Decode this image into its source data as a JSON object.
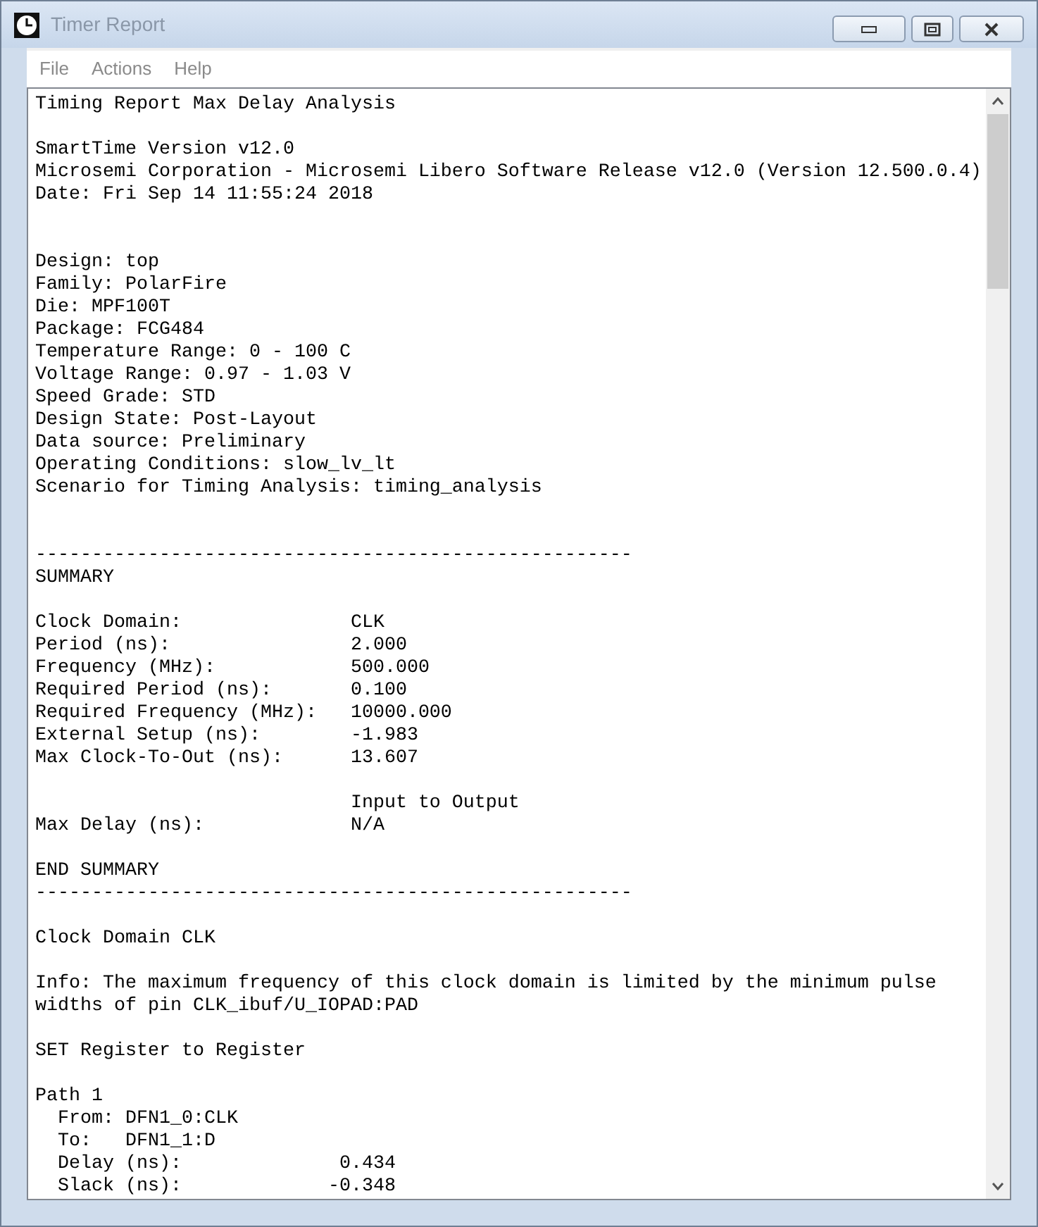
{
  "window": {
    "title": "Timer Report"
  },
  "menu": [
    {
      "label": "File"
    },
    {
      "label": "Actions"
    },
    {
      "label": "Help"
    }
  ],
  "report": "Timing Report Max Delay Analysis\n\nSmartTime Version v12.0\nMicrosemi Corporation - Microsemi Libero Software Release v12.0 (Version 12.500.0.4)\nDate: Fri Sep 14 11:55:24 2018\n\n\nDesign: top\nFamily: PolarFire\nDie: MPF100T\nPackage: FCG484\nTemperature Range: 0 - 100 C\nVoltage Range: 0.97 - 1.03 V\nSpeed Grade: STD\nDesign State: Post-Layout\nData source: Preliminary\nOperating Conditions: slow_lv_lt\nScenario for Timing Analysis: timing_analysis\n\n\n-----------------------------------------------------\nSUMMARY\n\nClock Domain:               CLK\nPeriod (ns):                2.000\nFrequency (MHz):            500.000\nRequired Period (ns):       0.100\nRequired Frequency (MHz):   10000.000\nExternal Setup (ns):        -1.983\nMax Clock-To-Out (ns):      13.607\n\n                            Input to Output\nMax Delay (ns):             N/A\n\nEND SUMMARY\n-----------------------------------------------------\n\nClock Domain CLK\n\nInfo: The maximum frequency of this clock domain is limited by the minimum pulse\nwidths of pin CLK_ibuf/U_IOPAD:PAD\n\nSET Register to Register\n\nPath 1\n  From: DFN1_0:CLK\n  To:   DFN1_1:D\n  Delay (ns):              0.434\n  Slack (ns):             -0.348"
}
